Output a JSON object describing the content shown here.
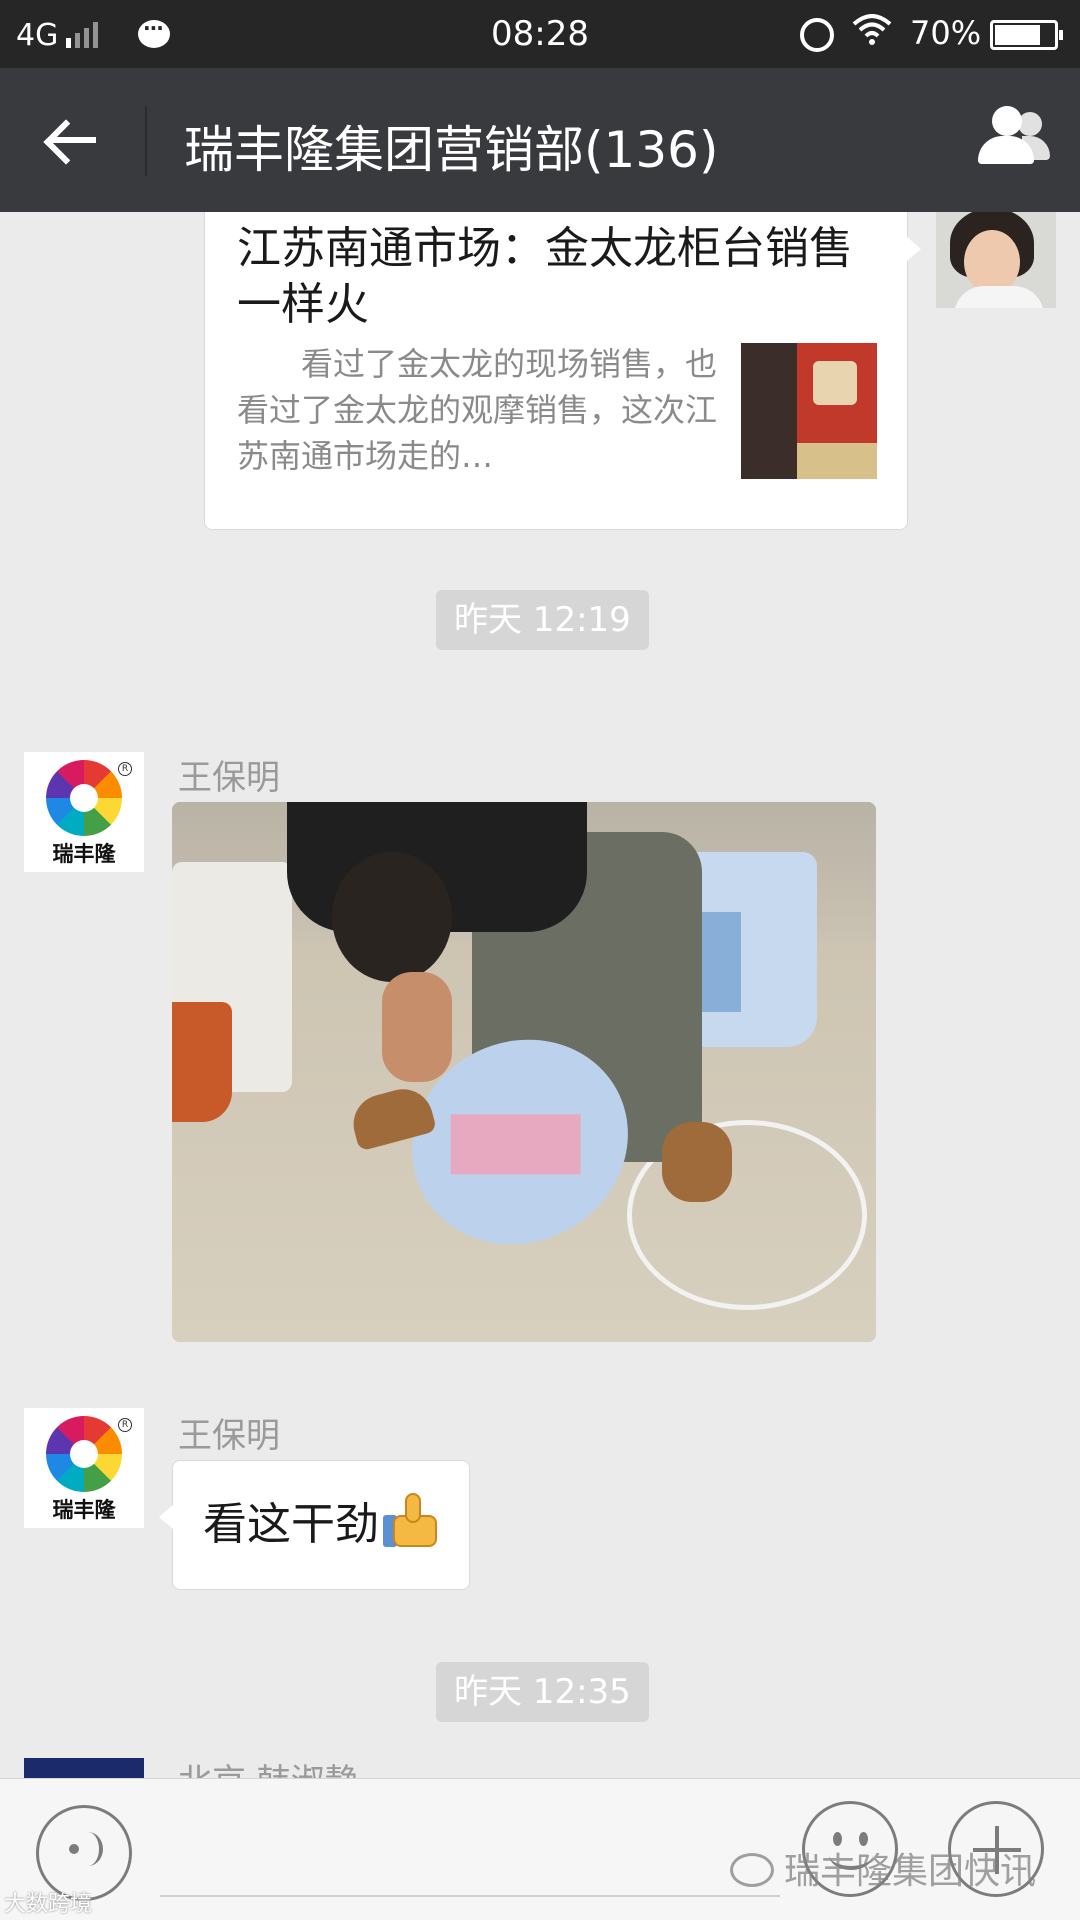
{
  "status_bar": {
    "network": "4G",
    "time": "08:28",
    "battery": "70%",
    "battery_level": 0.7,
    "icons": [
      "signal-icon",
      "message-notification-icon",
      "alarm-icon",
      "wifi-icon",
      "battery-icon"
    ]
  },
  "header": {
    "title": "瑞丰隆集团营销部(136)",
    "back_icon": "arrow-left-icon",
    "members_icon": "group-members-icon"
  },
  "messages": {
    "link_card": {
      "title": "江苏南通市场：金太龙柜台销售一样火",
      "description": "　　看过了金太龙的现场销售，也看过了金太龙的观摩销售，这次江苏南通市场走的…"
    },
    "time_1": "昨天 12:19",
    "photo_message": {
      "sender": "王保明",
      "avatar_logo_text": "瑞丰隆"
    },
    "text_message": {
      "sender": "王保明",
      "avatar_logo_text": "瑞丰隆",
      "text": "看这干劲",
      "emoji": "thumbs-up-icon"
    },
    "time_2": "昨天 12:35",
    "partial_sender": "北京 韩淑静"
  },
  "input_bar": {
    "voice_icon": "voice-icon",
    "emoji_icon": "emoji-icon",
    "plus_icon": "plus-icon"
  },
  "watermarks": {
    "right": "瑞丰隆集团快讯",
    "left": "大数跨境"
  },
  "colors": {
    "status_bar": "#262626",
    "title_bar": "#383a3e",
    "chat_background": "#ebebeb",
    "time_label": "#d6d6d6"
  }
}
